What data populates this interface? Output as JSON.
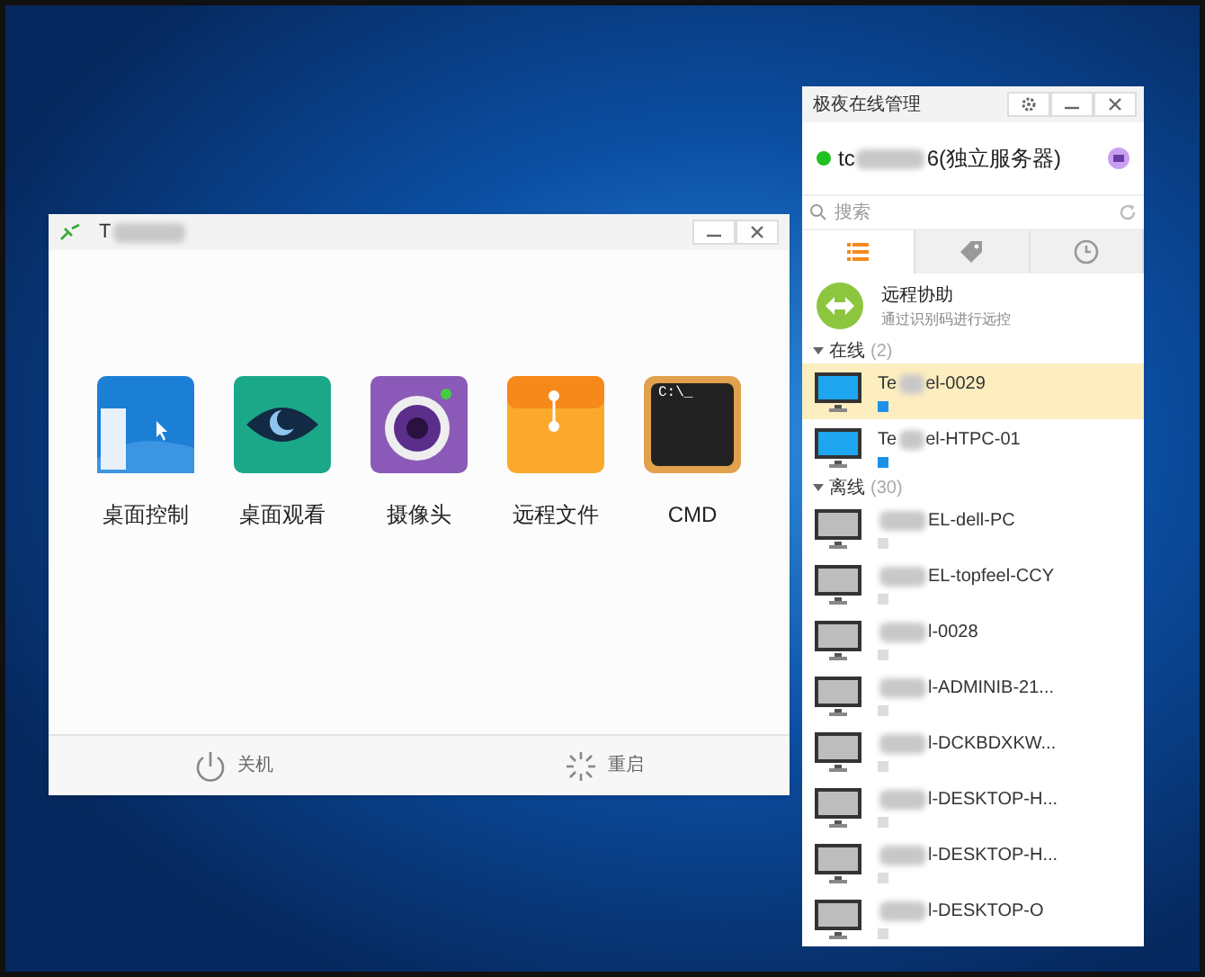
{
  "device_window": {
    "title_prefix": "T",
    "apps": [
      {
        "kind": "desktop",
        "label": "桌面控制"
      },
      {
        "kind": "eye",
        "label": "桌面观看"
      },
      {
        "kind": "camera",
        "label": "摄像头"
      },
      {
        "kind": "folder",
        "label": "远程文件"
      },
      {
        "kind": "terminal",
        "label": "CMD",
        "screen_text": "C:\\_"
      }
    ],
    "footer": [
      {
        "kind": "power",
        "label": "关机"
      },
      {
        "kind": "restart",
        "label": "重启"
      }
    ]
  },
  "manager": {
    "title": "极夜在线管理",
    "account": {
      "prefix": "tc",
      "suffix": "6(独立服务器)",
      "online": true
    },
    "search": {
      "placeholder": "搜索"
    },
    "tabs": [
      {
        "kind": "list",
        "selected": true
      },
      {
        "kind": "tag",
        "selected": false
      },
      {
        "kind": "clock",
        "selected": false
      }
    ],
    "remote_help": {
      "title": "远程协助",
      "subtitle": "通过识别码进行远控"
    },
    "groups": [
      {
        "name": "在线",
        "count": "(2)",
        "expanded": true,
        "online": true,
        "devices": [
          {
            "prefix": "Te",
            "suffix": "el-0029",
            "selected": true
          },
          {
            "prefix": "Te",
            "suffix": "el-HTPC-01",
            "selected": false
          }
        ]
      },
      {
        "name": "离线",
        "count": "(30)",
        "expanded": true,
        "online": false,
        "devices": [
          {
            "suffix": "EL-dell-PC",
            "selected": false
          },
          {
            "suffix": "EL-topfeel-CCY",
            "selected": false
          },
          {
            "suffix": "l-0028",
            "selected": false
          },
          {
            "suffix": "l-ADMINIB-21...",
            "selected": false
          },
          {
            "suffix": "l-DCKBDXKW...",
            "selected": false
          },
          {
            "suffix": "l-DESKTOP-H...",
            "selected": false
          },
          {
            "suffix": "l-DESKTOP-H...",
            "selected": false
          },
          {
            "suffix": "l-DESKTOP-O",
            "selected": false
          }
        ]
      }
    ]
  }
}
